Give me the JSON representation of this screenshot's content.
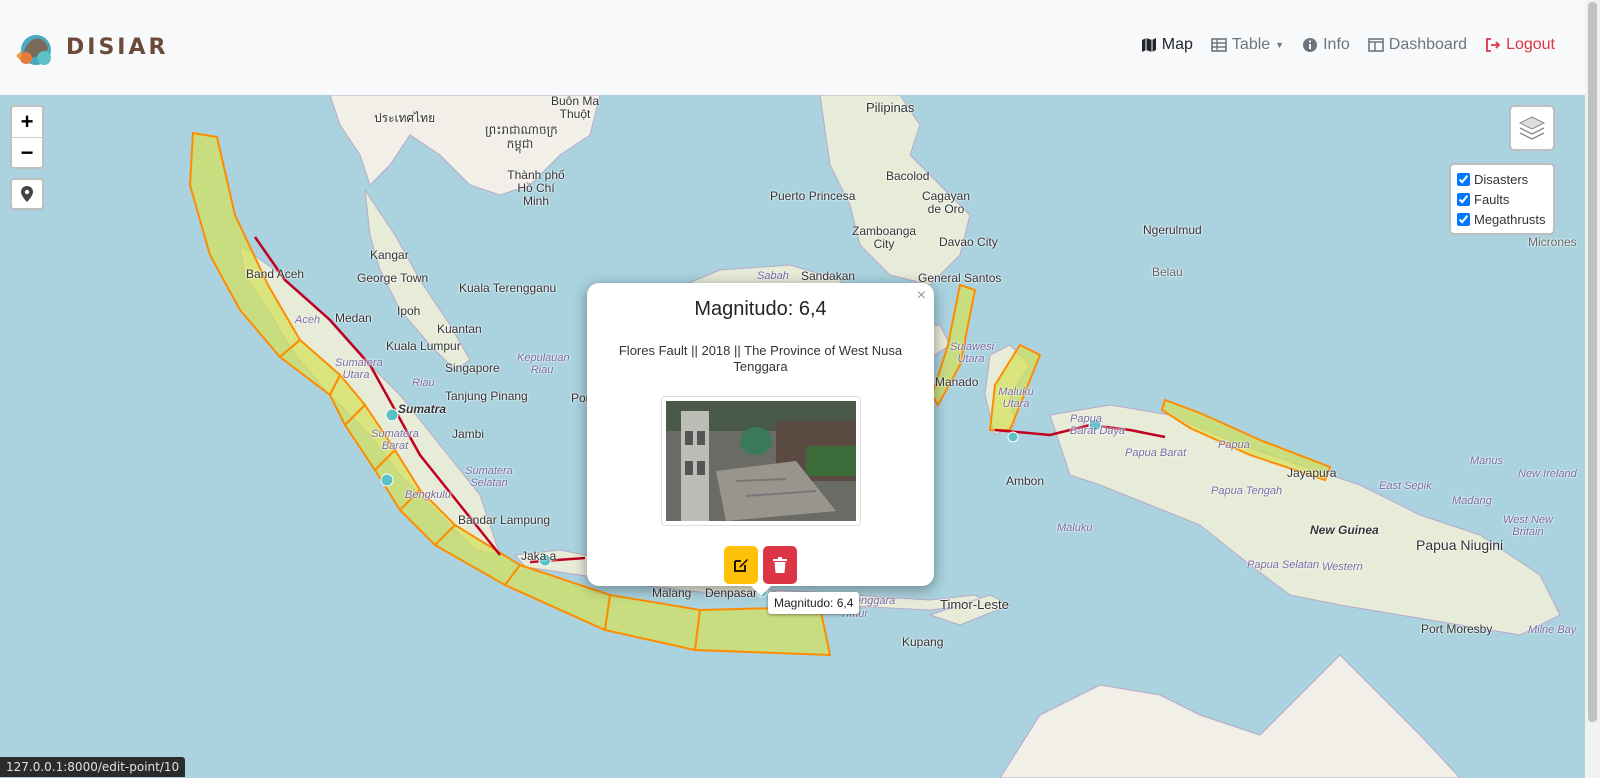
{
  "brand": {
    "name": "DISIAR"
  },
  "nav": {
    "map": "Map",
    "table": "Table",
    "info": "Info",
    "dashboard": "Dashboard",
    "logout": "Logout"
  },
  "zoom": {
    "in": "+",
    "out": "−"
  },
  "overlays": {
    "items": [
      {
        "label": "Disasters",
        "checked": true
      },
      {
        "label": "Faults",
        "checked": true
      },
      {
        "label": "Megathrusts",
        "checked": true
      }
    ]
  },
  "map_labels": {
    "buon_ma_thuot": "Buôn Ma Thuột",
    "thailand": "ประเทศไทย",
    "cambodia": "ព្រះរាជាណាចក្រ កម្ពុជា",
    "hcmc": "Thành phố Hồ Chí Minh",
    "pilipinas": "Pilipinas",
    "puerto_princesa": "Puerto Princesa",
    "bacolod": "Bacolod",
    "cagayan": "Cagayan de Oro",
    "zamboanga": "Zamboanga City",
    "davao": "Davao City",
    "ngerulmud": "Ngerulmud",
    "belau": "Belau",
    "micronesia": "Micrones",
    "kangar": "Kangar",
    "george_town": "George Town",
    "kuala_terengganu": "Kuala Terengganu",
    "ipoh": "Ipoh",
    "kuantan": "Kuantan",
    "kuala_lumpur": "Kuala Lumpur",
    "singapore": "Singapore",
    "tanjung_pinang": "Tanjung Pinang",
    "jambi": "Jambi",
    "banda_aceh": "Band  Aceh",
    "aceh": "Aceh",
    "medan": "Medan",
    "sumatera_utara": "Sumatera Utara",
    "riau": "Riau",
    "sumatra": "Sumatra",
    "sumatera_barat": "Sumatera Barat",
    "sumatera_selatan": "Sumatera Selatan",
    "bengkulu": "Bengkulu",
    "bandar_lampung": "Bandar Lampung",
    "jakarta": "Jaka  a",
    "kepulauan_riau": "Kepulauan Riau",
    "sabah": "Sabah",
    "sandakan": "Sandakan",
    "general_santos": "General Santos",
    "sulawesi_utara": "Sulawesi Utara",
    "manado": "Manado",
    "maluku_utara": "Maluku Utara",
    "papua_barat_daya": "Papua Barat Daya",
    "papua_barat": "Papua Barat",
    "ambon": "Ambon",
    "maluku": "Maluku",
    "papua": "Papua",
    "jayapura": "Jayapura",
    "papua_tengah": "Papua Tengah",
    "papua_selatan": "Papua Selatan",
    "new_guinea": "New Guinea",
    "papua_niugini": "Papua Niugini",
    "east_sepik": "East Sepik",
    "madang": "Madang",
    "manus": "Manus",
    "west_new_britain": "West New Britain",
    "new_ireland": "New Ireland",
    "western": "Western",
    "port_moresby": "Port Moresby",
    "milne_bay": "Milne Bay",
    "malang": "Malang",
    "denpasar": "Denpasar",
    "ntt": "a Tenggara Timur",
    "timor_leste": "Timor-Leste",
    "kupang": "Kupang",
    "pon": "Por"
  },
  "popup": {
    "title": "Magnitudo: 6,4",
    "description": "Flores Fault || 2018 || The Province of West Nusa Tenggara",
    "close": "×"
  },
  "tooltip": {
    "text": "Magnitudo: 6,4"
  },
  "status_url": "127.0.0.1:8000/edit-point/10",
  "colors": {
    "sea": "#aad3df",
    "land": "#f2efe9",
    "megathrust_fill": "#d4e157",
    "megathrust_stroke": "#ff8c00",
    "fault": "#c00020",
    "edit": "#ffc107",
    "delete": "#dc3545",
    "logout": "#dc3545"
  },
  "icons": [
    "map-icon",
    "table-icon",
    "info-icon",
    "dashboard-icon",
    "logout-icon",
    "locate-icon",
    "layers-icon",
    "edit-icon",
    "trash-icon"
  ]
}
